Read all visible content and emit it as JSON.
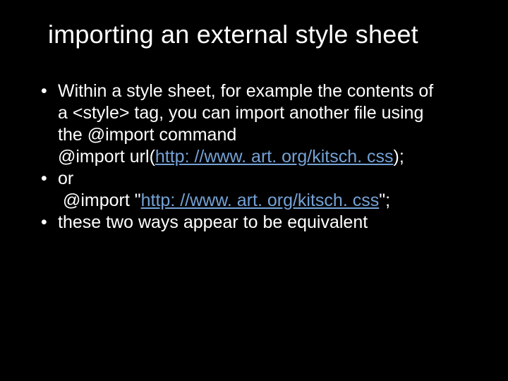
{
  "title": "importing an external style sheet",
  "bullet1_line1": "Within a style sheet, for example the contents of",
  "bullet1_line2": "a <style> tag, you can import another file using",
  "bullet1_line3": "the @import command",
  "code1_prefix": "@import url(",
  "code1_link": "http: //www. art. org/kitsch. css",
  "code1_suffix": ");",
  "bullet2": "or",
  "code2_prefix": "@import \"",
  "code2_link": "http: //www. art. org/kitsch. css",
  "code2_suffix": "\";",
  "bullet3": "these two ways appear to be equivalent"
}
